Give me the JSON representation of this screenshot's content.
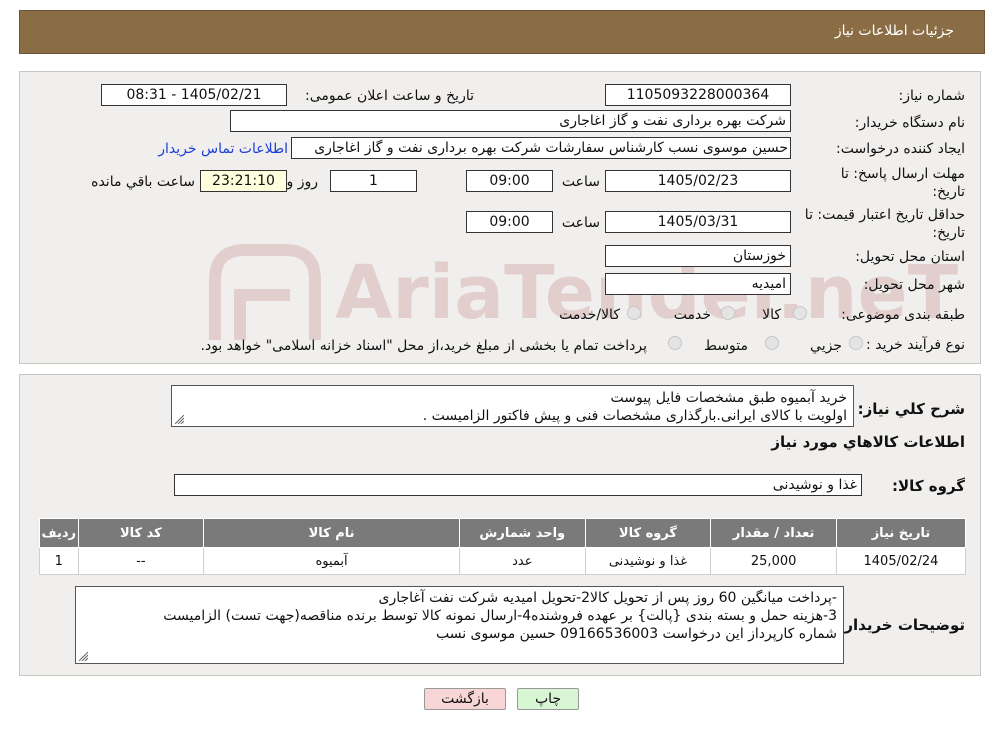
{
  "page_title": "جزئیات اطلاعات نیاز",
  "need_number": {
    "label": "شماره نیاز:",
    "value": "1105093228000364"
  },
  "announce_datetime": {
    "label": "تاریخ و ساعت اعلان عمومی:",
    "value": "1405/02/21 - 08:31"
  },
  "buyer_org": {
    "label": "نام دستگاه خریدار:",
    "value": "شرکت بهره برداری نفت و گاز اغاجاری"
  },
  "requester": {
    "label": "ایجاد کننده درخواست:",
    "value": "حسین موسوی نسب کارشناس سفارشات شرکت بهره برداری نفت و گاز اغاجاری",
    "contact_link": "اطلاعات تماس خریدار"
  },
  "reply_deadline": {
    "label": "مهلت ارسال پاسخ: تا تاریخ:",
    "date": "1405/02/23",
    "time_label": "ساعت",
    "time": "09:00",
    "days": "1",
    "days_label": "روز و",
    "remaining": "23:21:10",
    "remaining_label": "ساعت باقي مانده"
  },
  "price_validity": {
    "label": "حداقل تاریخ اعتبار قیمت: تا تاریخ:",
    "date": "1405/03/31",
    "time_label": "ساعت",
    "time": "09:00"
  },
  "delivery_province": {
    "label": "استان محل تحویل:",
    "value": "خوزستان"
  },
  "delivery_city": {
    "label": "شهر محل تحویل:",
    "value": "امیدیه"
  },
  "category": {
    "label": "طبقه بندی موضوعی:",
    "options": [
      "کالا",
      "خدمت",
      "کالا/خدمت"
    ]
  },
  "purchase_type": {
    "label": "نوع فرآیند خرید :",
    "options": [
      "جزيي",
      "متوسط"
    ],
    "note": "پرداخت تمام یا بخشی از مبلغ خرید،از محل \"اسناد خزانه اسلامی\" خواهد بود."
  },
  "summary": {
    "label": "شرح کلي نياز:",
    "lines": [
      "خرید آبمیوه  طبق مشخصات فایل پیوست",
      "اولویت با کالای ایرانی.بارگذاری مشخصات فنی و پیش فاکتور الزامیست ."
    ]
  },
  "goods_info_title": "اطلاعات کالاهاي مورد نياز",
  "goods_group": {
    "label": "گروه کالا:",
    "value": "غذا و نوشیدنی"
  },
  "table": {
    "headers": [
      "رديف",
      "کد کالا",
      "نام کالا",
      "واحد شمارش",
      "گروه کالا",
      "تعداد / مقدار",
      "تاریخ نیاز"
    ],
    "rows": [
      [
        "1",
        "--",
        "آبمیوه",
        "عدد",
        "غذا و نوشیدنی",
        "25,000",
        "1405/02/24"
      ]
    ]
  },
  "buyer_notes": {
    "label": "توضیحات خریدار:",
    "lines": [
      "-پرداخت میانگین 60 روز پس از تحویل کالا2-تحویل امیدیه شرکت نفت آغاجاری",
      "3-هزینه حمل  و بسته بندی {پالت} بر عهده فروشنده4-ارسال نمونه کالا توسط برنده مناقصه(جهت تست) الزامیست",
      "شماره کارپرداز این درخواست 09166536003 حسین موسوی نسب"
    ]
  },
  "buttons": {
    "print": "چاپ",
    "back": "بازگشت"
  },
  "watermark_text": "AriaTender.neT",
  "colors": {
    "header_bg": "#8b6d45",
    "panel_bg": "#f0efed",
    "table_header_bg": "#7a7a7a",
    "back_button_bg": "#f8d6d6",
    "print_button_bg": "#d8f5d4",
    "link": "#1a3fd6"
  }
}
